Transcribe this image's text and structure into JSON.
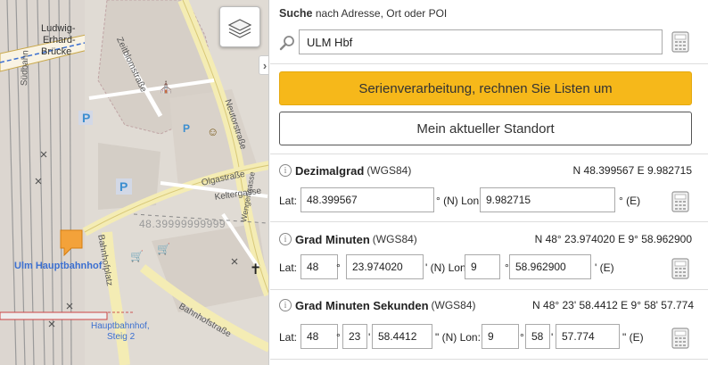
{
  "map": {
    "labels": {
      "bridge_1": "Ludwig-",
      "bridge_2": "Erhard-",
      "bridge_3": "Brücke",
      "rail_label": "Südbahn",
      "zeitblom": "Zeitblomstraße",
      "neutor": "Neutorstraße",
      "olga": "Olgastraße",
      "keltergasse": "Keltergasse",
      "weinhof": "Wengengasse",
      "bahnhofplatz": "Bahnhofplatz",
      "bahnhofstrasse": "Bahnhofstraße",
      "station": "Ulm Hauptbahnhof",
      "steig_1": "Hauptbahnhof,",
      "steig_2": "Steig 2",
      "coordinate_readout": "48.39999999999"
    }
  },
  "search": {
    "title_bold": "Suche",
    "title_rest": " nach Adresse, Ort oder POI",
    "value": "ULM Hbf"
  },
  "buttons": {
    "batch": "Serienverarbeitung, rechnen Sie Listen um",
    "location": "Mein aktueller Standort"
  },
  "decimal": {
    "title": "Dezimalgrad",
    "ref": "(WGS84)",
    "summary": "N 48.399567 E 9.982715",
    "lat_label": "Lat:",
    "lat_value": "48.399567",
    "lat_suffix": "° (N) Lon:",
    "lon_value": "9.982715",
    "lon_suffix": "° (E)"
  },
  "dm": {
    "title": "Grad Minuten",
    "ref": "(WGS84)",
    "summary": "N 48° 23.974020 E 9° 58.962900",
    "lat_label": "Lat:",
    "lat_deg": "48",
    "deg_sign": "°",
    "lat_min": "23.974020",
    "lat_suffix": "' (N) Lon:",
    "lon_deg": "9",
    "lon_min": "58.962900",
    "lon_suffix": "' (E)"
  },
  "dms": {
    "title": "Grad Minuten Sekunden",
    "ref": "(WGS84)",
    "summary": "N 48° 23' 58.4412 E 9° 58' 57.774",
    "lat_label": "Lat:",
    "lat_deg": "48",
    "deg_sign": "°",
    "lat_min": "23",
    "min_sign": "'",
    "lat_sec": "58.4412",
    "lat_suffix": "\" (N) Lon:",
    "lon_deg": "9",
    "lon_min": "58",
    "lon_sec": "57.774",
    "lon_suffix": "\" (E)"
  },
  "colors": {
    "accent_yellow": "#f6b81a",
    "station_blue": "#3b6fd0"
  },
  "icons": {
    "search": "magnifier-icon",
    "calculator": "calculator-icon",
    "layers": "layers-icon",
    "info": "info-icon",
    "marker": "map-marker-icon"
  }
}
